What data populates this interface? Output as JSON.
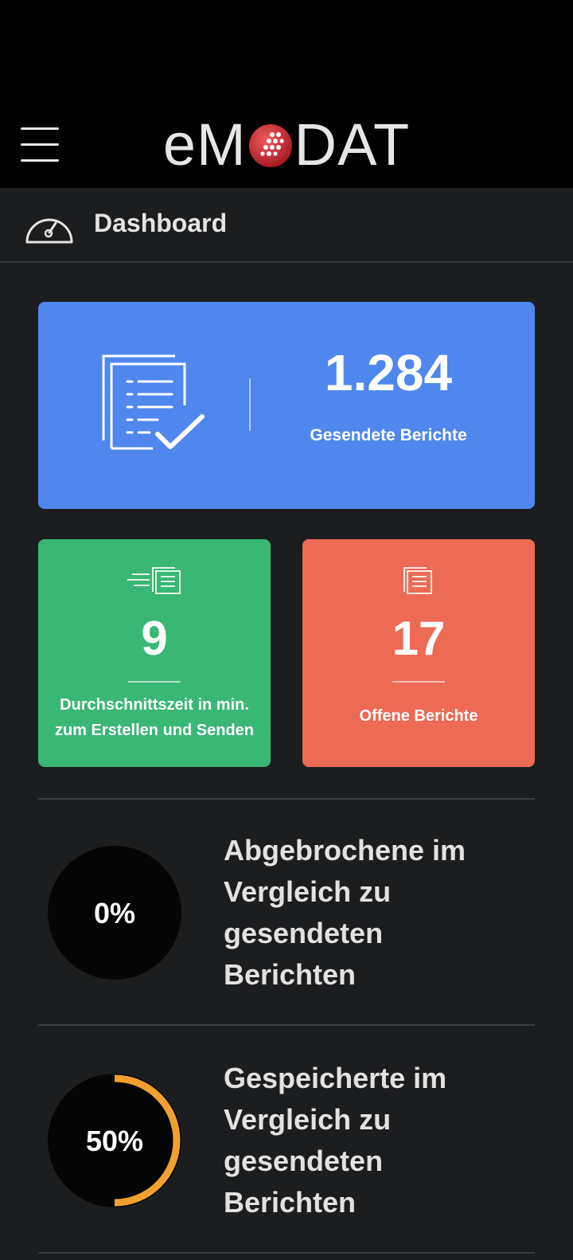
{
  "header": {
    "logo_prefix": "eM",
    "logo_suffix": "DAT",
    "menu_icon": "hamburger-icon"
  },
  "nav": {
    "title": "Dashboard",
    "icon": "speedometer-icon"
  },
  "cards": {
    "sent": {
      "value": "1.284",
      "label": "Gesendete Berichte",
      "color": "#4f87ee",
      "icon": "document-check-icon"
    },
    "avg_time": {
      "value": "9",
      "label_line1": "Durchschnittszeit in min.",
      "label_line2": "zum Erstellen und Senden",
      "color": "#39b774",
      "icon": "fast-document-icon"
    },
    "open": {
      "value": "17",
      "label": "Offene Berichte",
      "color": "#ed6a55",
      "icon": "document-icon"
    }
  },
  "stats": [
    {
      "percent_text": "0%",
      "percent": 0,
      "line1": "Abgebrochene im",
      "line2": "Vergleich zu",
      "line3": "gesendeten",
      "line4": "Berichten",
      "ring_color": "#f0a030"
    },
    {
      "percent_text": "50%",
      "percent": 50,
      "line1": "Gespeicherte im",
      "line2": "Vergleich zu",
      "line3": "gesendeten",
      "line4": "Berichten",
      "ring_color": "#f0a030"
    }
  ]
}
